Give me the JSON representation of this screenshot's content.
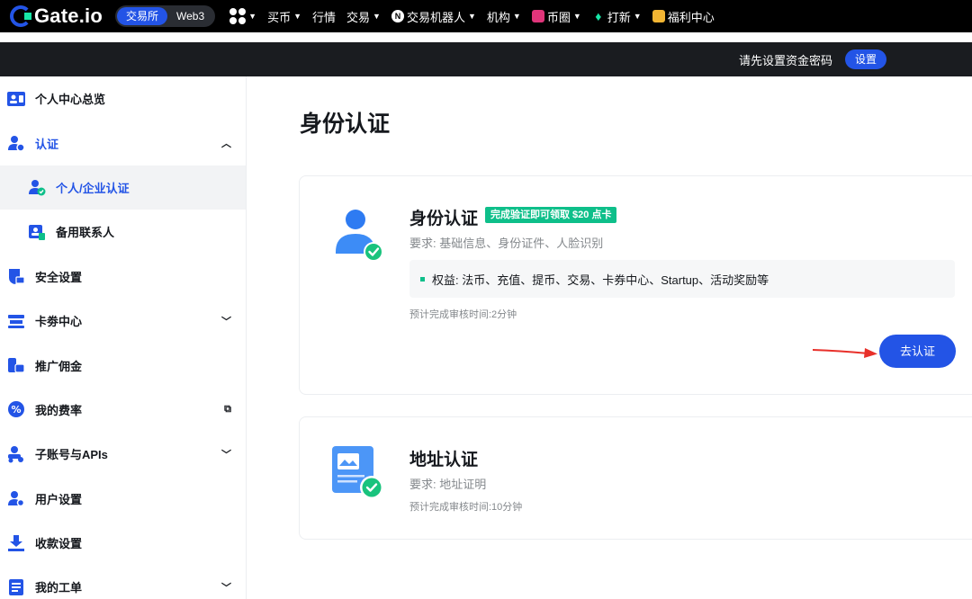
{
  "topnav": {
    "logo": "Gate.io",
    "mode_active": "交易所",
    "mode_other": "Web3",
    "items": [
      {
        "label": "买币",
        "icon": "none"
      },
      {
        "label": "行情",
        "icon": "none"
      },
      {
        "label": "交易",
        "icon": "none"
      },
      {
        "label": "交易机器人",
        "icon": "bot-icon"
      },
      {
        "label": "机构",
        "icon": "none"
      },
      {
        "label": "币圈",
        "icon": "chart-icon"
      },
      {
        "label": "打新",
        "icon": "flame-icon"
      },
      {
        "label": "福利中心",
        "icon": "gift-icon"
      }
    ]
  },
  "subbar": {
    "text": "请先设置资金密码",
    "button": "设置"
  },
  "sidebar": {
    "items": [
      {
        "label": "个人中心总览",
        "icon": "id-card-icon"
      },
      {
        "label": "认证",
        "icon": "user-shield-icon"
      },
      {
        "label": "个人/企业认证",
        "icon": "user-check-icon"
      },
      {
        "label": "备用联系人",
        "icon": "contact-card-icon"
      },
      {
        "label": "安全设置",
        "icon": "lock-icon"
      },
      {
        "label": "卡劵中心",
        "icon": "ticket-icon"
      },
      {
        "label": "推广佣金",
        "icon": "wallet-icon"
      },
      {
        "label": "我的费率",
        "icon": "percent-icon"
      },
      {
        "label": "子账号与APIs",
        "icon": "subaccount-icon"
      },
      {
        "label": "用户设置",
        "icon": "user-gear-icon"
      },
      {
        "label": "收款设置",
        "icon": "download-icon"
      },
      {
        "label": "我的工单",
        "icon": "ticket-list-icon"
      }
    ]
  },
  "page": {
    "title": "身份认证"
  },
  "identity_card": {
    "title": "身份认证",
    "tag": "完成验证即可领取 $20 点卡",
    "requirement": "要求: 基础信息、身份证件、人脸识别",
    "benefits": "权益: 法币、充值、提币、交易、卡券中心、Startup、活动奖励等",
    "eta": "预计完成审核时间:2分钟",
    "button": "去认证"
  },
  "address_card": {
    "title": "地址认证",
    "requirement": "要求: 地址证明",
    "eta": "预计完成审核时间:10分钟"
  },
  "colors": {
    "brand": "#2354e6",
    "accent_green": "#0ebf8a",
    "annotation_arrow": "#e8302a"
  }
}
